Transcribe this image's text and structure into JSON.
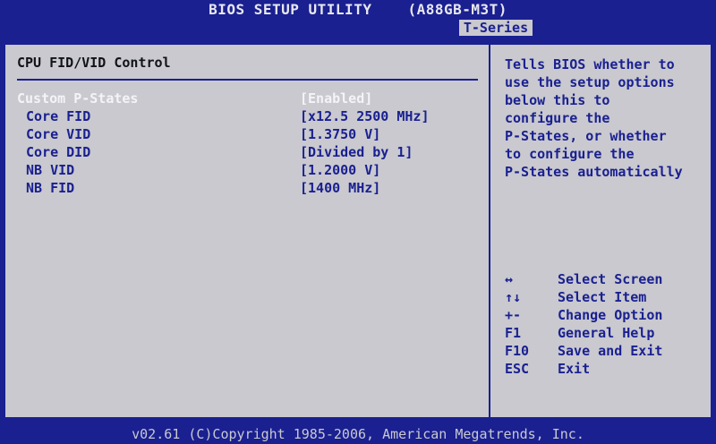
{
  "header": {
    "title": "BIOS SETUP UTILITY",
    "board": "(A88GB-M3T)",
    "active_tab": "T-Series"
  },
  "main": {
    "section_title": "CPU FID/VID Control",
    "options": [
      {
        "label": "Custom P-States",
        "value": "[Enabled]"
      },
      {
        "label": "Core FID",
        "value": "[x12.5 2500 MHz]"
      },
      {
        "label": "Core VID",
        "value": "[1.3750 V]"
      },
      {
        "label": "Core DID",
        "value": "[Divided by 1]"
      },
      {
        "label": "NB VID",
        "value": "[1.2000 V]"
      },
      {
        "label": "NB FID",
        "value": "[1400 MHz]"
      }
    ]
  },
  "help": {
    "lines": [
      "Tells BIOS whether to",
      "use the setup options",
      "below this to",
      "configure the",
      "P-States, or whether",
      "to configure the",
      "P-States automatically"
    ],
    "keys": [
      {
        "key": "↔",
        "desc": "Select Screen"
      },
      {
        "key": "↑↓",
        "desc": "Select Item"
      },
      {
        "key": "+-",
        "desc": "Change Option"
      },
      {
        "key": "F1",
        "desc": "General Help"
      },
      {
        "key": "F10",
        "desc": "Save and Exit"
      },
      {
        "key": "ESC",
        "desc": "Exit"
      }
    ]
  },
  "footer": {
    "copyright": "v02.61 (C)Copyright 1985-2006, American Megatrends, Inc."
  },
  "colors": {
    "frame_blue": "#1a2090",
    "panel_gray": "#c9c9cf",
    "selected_text": "#f4f4f8"
  }
}
